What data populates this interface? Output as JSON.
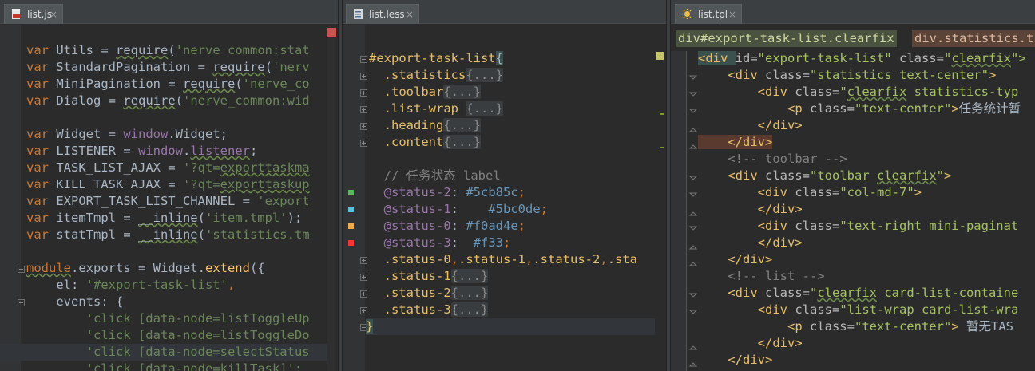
{
  "tabs": {
    "left": "list.js",
    "mid": "list.less",
    "right": "list.tpl",
    "close": "×"
  },
  "colors": {
    "status2": "#5cb85c",
    "status1": "#5bc0de",
    "status0": "#f0ad4e",
    "status3": "#f33"
  },
  "breadcrumb": {
    "first": "div#export-task-list.clearfix",
    "second": "div.statistics.t"
  },
  "js": {
    "l1a": "var",
    "l1b": " Utils = ",
    "l1c": "require",
    "l1d": "(",
    "l1e": "'nerve_common:stat",
    "l2a": "var",
    "l2b": " StandardPagination = ",
    "l2c": "require",
    "l2d": "(",
    "l2e": "'nerv",
    "l3a": "var",
    "l3b": " MiniPagination = ",
    "l3c": "require",
    "l3d": "(",
    "l3e": "'nerve_co",
    "l4a": "var",
    "l4b": " Dialog = ",
    "l4c": "require",
    "l4d": "(",
    "l4e": "'nerve_common:wid",
    "l5a": "var",
    "l5b": " Widget = ",
    "l5c": "window",
    "l5d": ".Widget;",
    "l6a": "var",
    "l6b": " LISTENER = ",
    "l6c": "window",
    "l6d": ".",
    "l6e": "listener",
    "l6f": ";",
    "l7a": "var",
    "l7b": " TASK_LIST_AJAX = ",
    "l7c": "'?qt=",
    "l7d": "exporttaskma",
    "l8a": "var",
    "l8b": " KILL_TASK_AJAX = ",
    "l8c": "'?qt=",
    "l8d": "exporttaskup",
    "l9a": "var",
    "l9b": " EXPORT_TASK_LIST_CHANNEL = ",
    "l9c": "'export",
    "l10a": "var",
    "l10b": " itemTmpl = ",
    "l10c": "__inline",
    "l10d": "(",
    "l10e": "'item.tmpl'",
    "l10f": ");",
    "l11a": "var",
    "l11b": " statTmpl = ",
    "l11c": "__inline",
    "l11d": "(",
    "l11e": "'statistics.tm",
    "l12a": "module",
    "l12b": ".exports = Widget.",
    "l12c": "extend",
    "l12d": "({",
    "l13a": "    el: ",
    "l13b": "'#export-task-list'",
    "l13c": ",",
    "l14a": "    events: {",
    "l15a": "        ",
    "l15b": "'click [data-node=listToggleUp",
    "l16a": "        ",
    "l16b": "'click [data-node=listToggleDo",
    "l17a": "        ",
    "l17b": "'click [data-node=selectStatus",
    "l18a": "        ",
    "l18b": "'click [data-node=killTask]':"
  },
  "less": {
    "l1a": "#export-task-list",
    "l1b": "{",
    "l2a": "  .statistics",
    "l2b": "{...}",
    "l3a": "  .toolbar",
    "l3b": "{...}",
    "l4a": "  .list-wrap ",
    "l4b": "{...}",
    "l5a": "  .heading",
    "l5b": "{...}",
    "l6a": "  .content",
    "l6b": "{...}",
    "l7a": "  // 任务状态 label",
    "l8a": "  @status-2",
    "l8b": ": ",
    "l8c": "#5cb85c",
    "l8d": ";",
    "l9a": "  @status-1",
    "l9b": ":    ",
    "l9c": "#5bc0de",
    "l9d": ";",
    "l10a": "  @status-0",
    "l10b": ": ",
    "l10c": "#f0ad4e",
    "l10d": ";",
    "l11a": "  @status-3",
    "l11b": ":  ",
    "l11c": "#f33",
    "l11d": ";",
    "l12a": "  .status-0",
    "l12b": ",",
    "l12c": ".status-1",
    "l12d": ",",
    "l12e": ".status-2",
    "l12f": ",",
    "l12g": ".sta",
    "l13a": "  .status-1",
    "l13b": "{...}",
    "l14a": "  .status-2",
    "l14b": "{...}",
    "l15a": "  .status-3",
    "l15b": "{...}",
    "l16a": "}"
  },
  "tpl": {
    "l1a": "<div ",
    "l1b": "id=",
    "l1c": "\"export-task-list\"",
    "l1d": " class=",
    "l1e": "\"",
    "l1f": "clearfix",
    "l1g": "\">",
    "l2a": "    <div ",
    "l2b": "class=",
    "l2c": "\"statistics text-center\"",
    "l2d": ">",
    "l3a": "        <div ",
    "l3b": "class=",
    "l3c": "\"",
    "l3d": "clearfix",
    "l3e": " statistics-typ",
    "l4a": "            <p ",
    "l4b": "class=",
    "l4c": "\"text-center\"",
    "l4d": ">",
    "l4e": "任务统计暂",
    "l5a": "        </div>",
    "l6a": "    </div>",
    "l7a": "    <!-- toolbar -->",
    "l8a": "    <div ",
    "l8b": "class=",
    "l8c": "\"toolbar ",
    "l8d": "clearfix",
    "l8e": "\"",
    "l8f": ">",
    "l9a": "        <div ",
    "l9b": "class=",
    "l9c": "\"col-md-7\"",
    "l9d": ">",
    "l10a": "        </div>",
    "l11a": "        <div ",
    "l11b": "class=",
    "l11c": "\"text-right mini-paginat",
    "l12a": "        </div>",
    "l13a": "    </div>",
    "l14a": "    <!-- list -->",
    "l15a": "    <div ",
    "l15b": "class=",
    "l15c": "\"",
    "l15d": "clearfix",
    "l15e": " card-list-containe",
    "l16a": "        <div ",
    "l16b": "class=",
    "l16c": "\"list-wrap card-list-wra",
    "l17a": "            <p ",
    "l17b": "class=",
    "l17c": "\"text-center\"",
    "l17d": ">",
    "l17e": " 暂无TAS",
    "l18a": "        </div>",
    "l19a": "    </div>"
  }
}
